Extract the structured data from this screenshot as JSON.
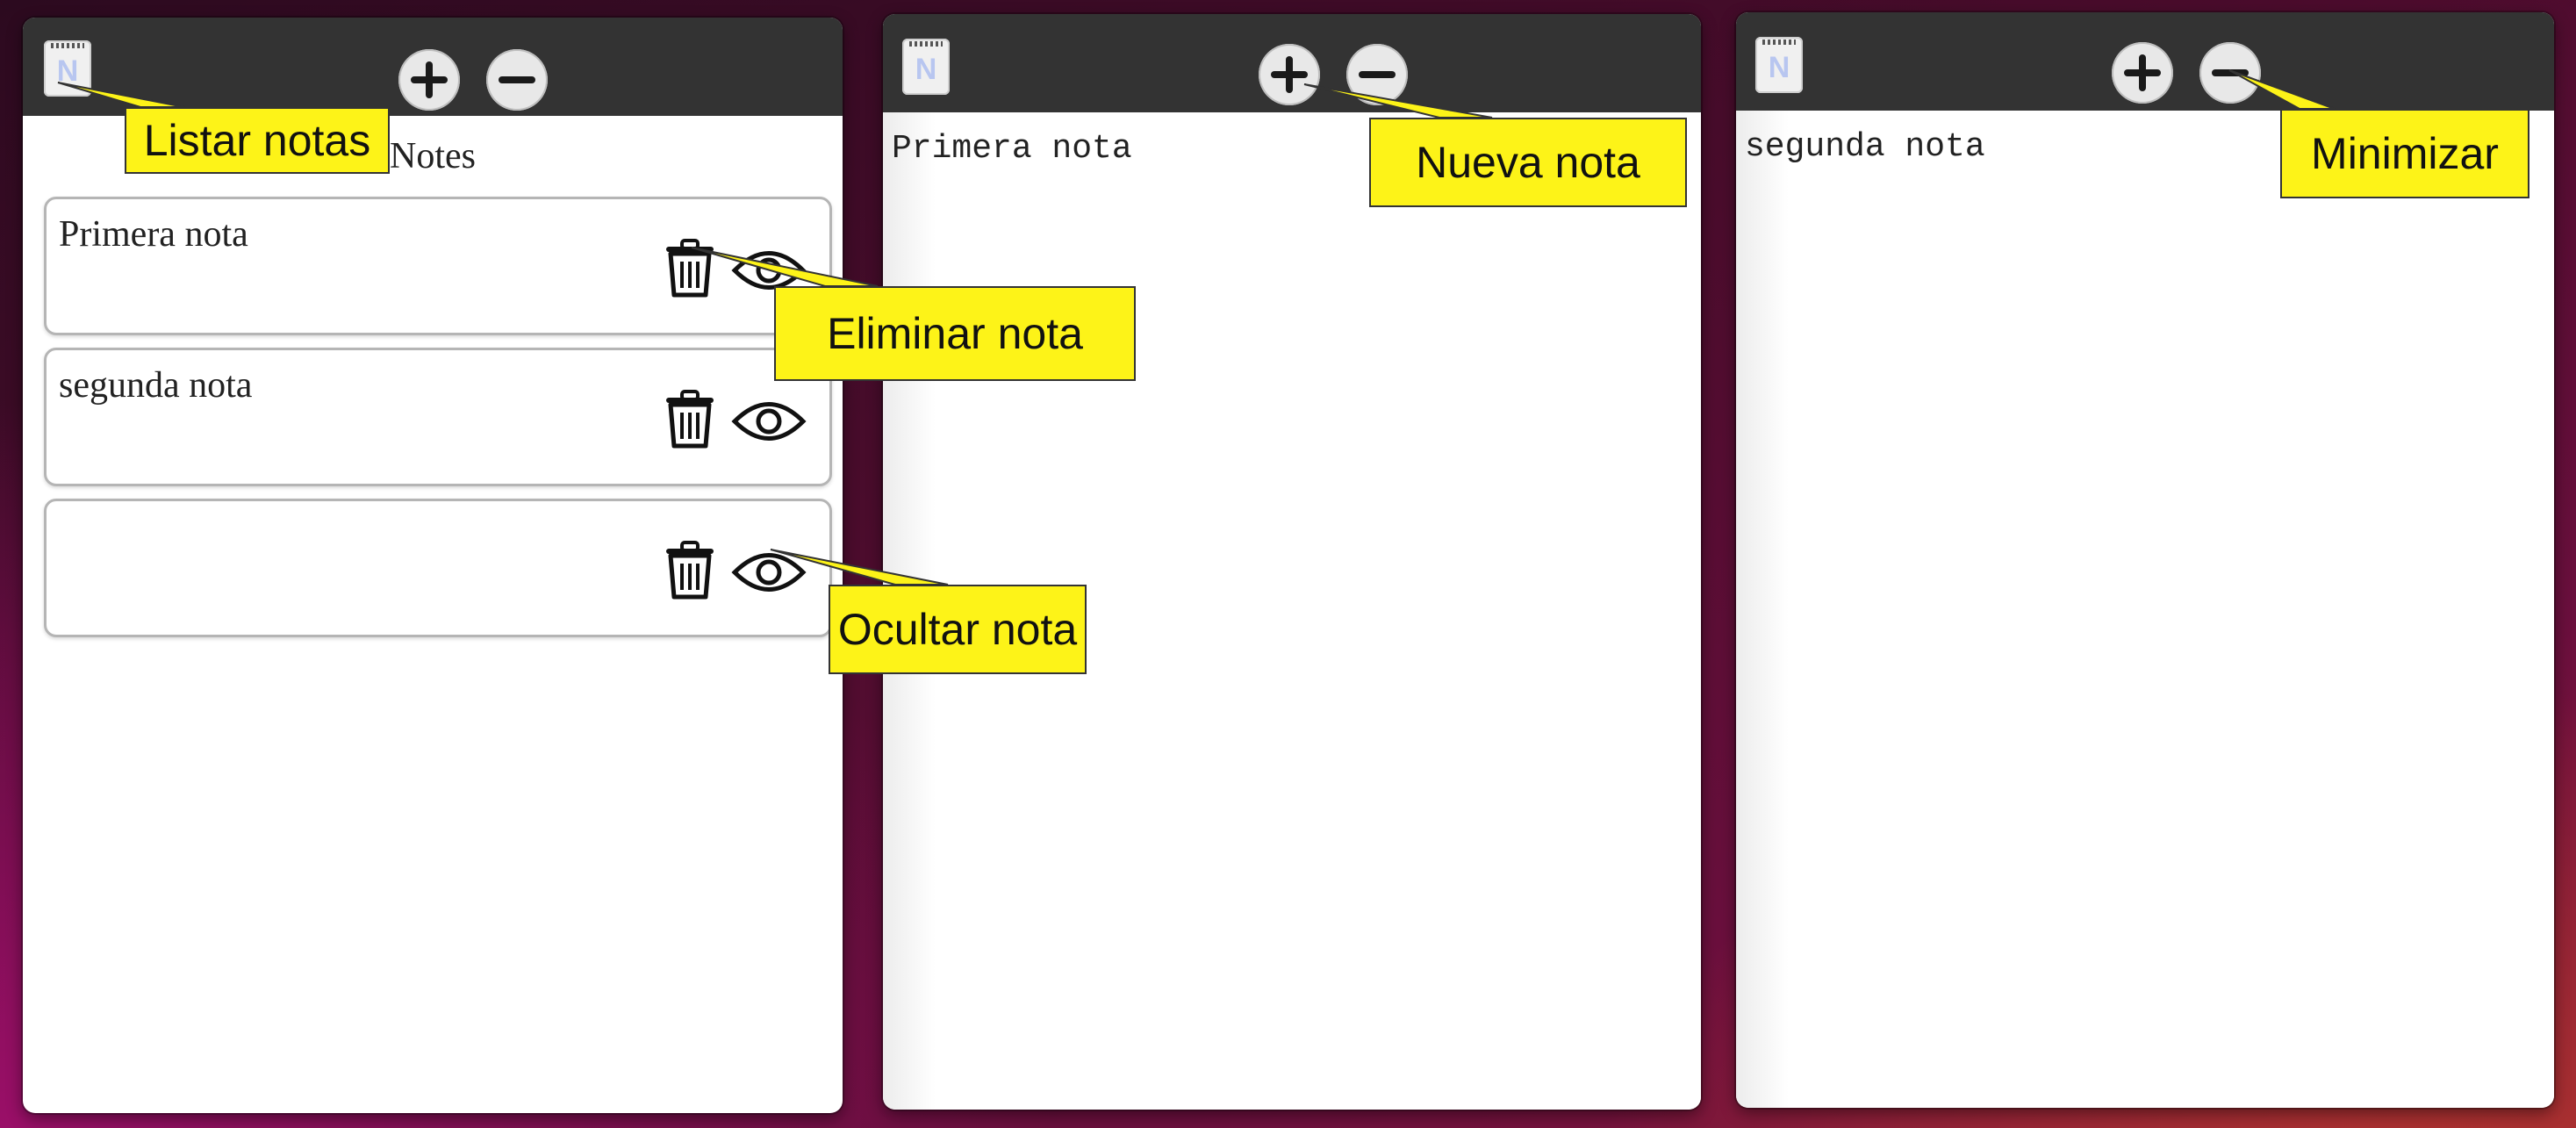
{
  "windows": {
    "list": {
      "icon": "notepad-icon",
      "icon_letter": "N",
      "header": "Notes",
      "notes": [
        {
          "text": "Primera nota"
        },
        {
          "text": "segunda nota"
        },
        {
          "text": ""
        }
      ]
    },
    "note1": {
      "icon_letter": "N",
      "content": "Primera nota"
    },
    "note2": {
      "icon_letter": "N",
      "content": "segunda nota"
    }
  },
  "titlebar_buttons": {
    "add": "plus-icon",
    "minimize": "minus-icon"
  },
  "note_actions": {
    "delete": "trash-icon",
    "hide": "eye-icon"
  },
  "callouts": {
    "list_notes": "Listar notas",
    "new_note": "Nueva nota",
    "delete_note": "Eliminar nota",
    "minimize": "Minimizar",
    "hide_note": "Ocultar nota"
  },
  "colors": {
    "titlebar": "#333333",
    "callout_bg": "#fdf318",
    "icon_letter": "#b8c6f0"
  }
}
